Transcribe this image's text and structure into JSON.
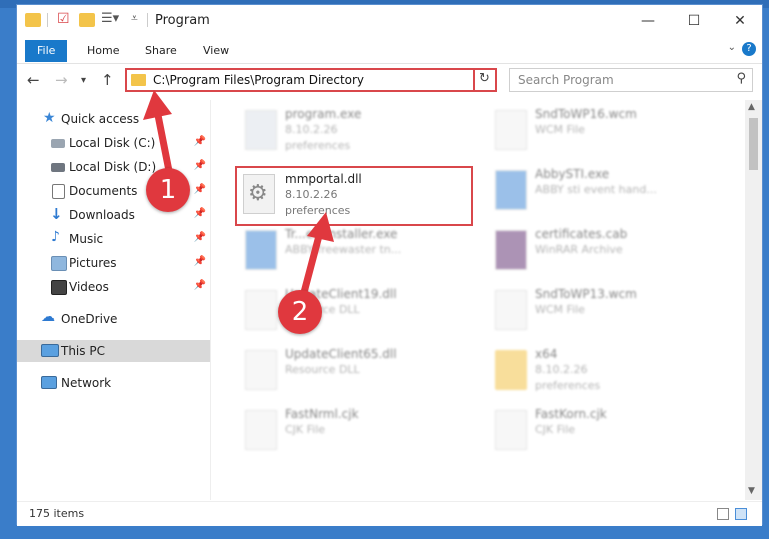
{
  "window": {
    "title": "Program"
  },
  "ribbon": {
    "tabs": [
      "File",
      "Home",
      "Share",
      "View"
    ],
    "help": "?"
  },
  "address": {
    "path": "C:\\Program Files\\Program Directory",
    "search_placeholder": "Search Program"
  },
  "sidebar": {
    "items": [
      {
        "label": "Quick access",
        "icon": "star-icon"
      },
      {
        "label": "Local Disk (C:)",
        "icon": "drive-icon"
      },
      {
        "label": "Local Disk (D:)",
        "icon": "drive-icon"
      },
      {
        "label": "Documents",
        "icon": "documents-icon"
      },
      {
        "label": "Downloads",
        "icon": "download-icon"
      },
      {
        "label": "Music",
        "icon": "music-icon"
      },
      {
        "label": "Pictures",
        "icon": "pictures-icon"
      },
      {
        "label": "Videos",
        "icon": "videos-icon"
      },
      {
        "label": "OneDrive",
        "icon": "cloud-icon"
      },
      {
        "label": "This PC",
        "icon": "computer-icon"
      },
      {
        "label": "Network",
        "icon": "network-icon"
      }
    ]
  },
  "files": [
    {
      "name": "program.exe",
      "line2": "8.10.2.26",
      "line3": "preferences"
    },
    {
      "name": "SndToWP16.wcm",
      "line2": "WCM File",
      "line3": ""
    },
    {
      "name": "mmportal.dll",
      "line2": "8.10.2.26",
      "line3": "preferences"
    },
    {
      "name": "AbbySTI.exe",
      "line2": "ABBY sti event hand...",
      "line3": ""
    },
    {
      "name": "Tr...emInstaller.exe",
      "line2": "ABBY freewaster tn...",
      "line3": ""
    },
    {
      "name": "certificates.cab",
      "line2": "WinRAR Archive",
      "line3": ""
    },
    {
      "name": "UpdateClient19.dll",
      "line2": "Resource DLL",
      "line3": ""
    },
    {
      "name": "SndToWP13.wcm",
      "line2": "WCM File",
      "line3": ""
    },
    {
      "name": "UpdateClient65.dll",
      "line2": "Resource DLL",
      "line3": ""
    },
    {
      "name": "x64",
      "line2": "8.10.2.26",
      "line3": "preferences"
    },
    {
      "name": "FastNrml.cjk",
      "line2": "CJK File",
      "line3": ""
    },
    {
      "name": "FastKorn.cjk",
      "line2": "CJK File",
      "line3": ""
    }
  ],
  "status": {
    "items_count": "175 items"
  },
  "callouts": [
    "1",
    "2"
  ],
  "colors": {
    "accent": "#1979ca",
    "highlight": "#d9474b",
    "callout": "#e0383e"
  }
}
